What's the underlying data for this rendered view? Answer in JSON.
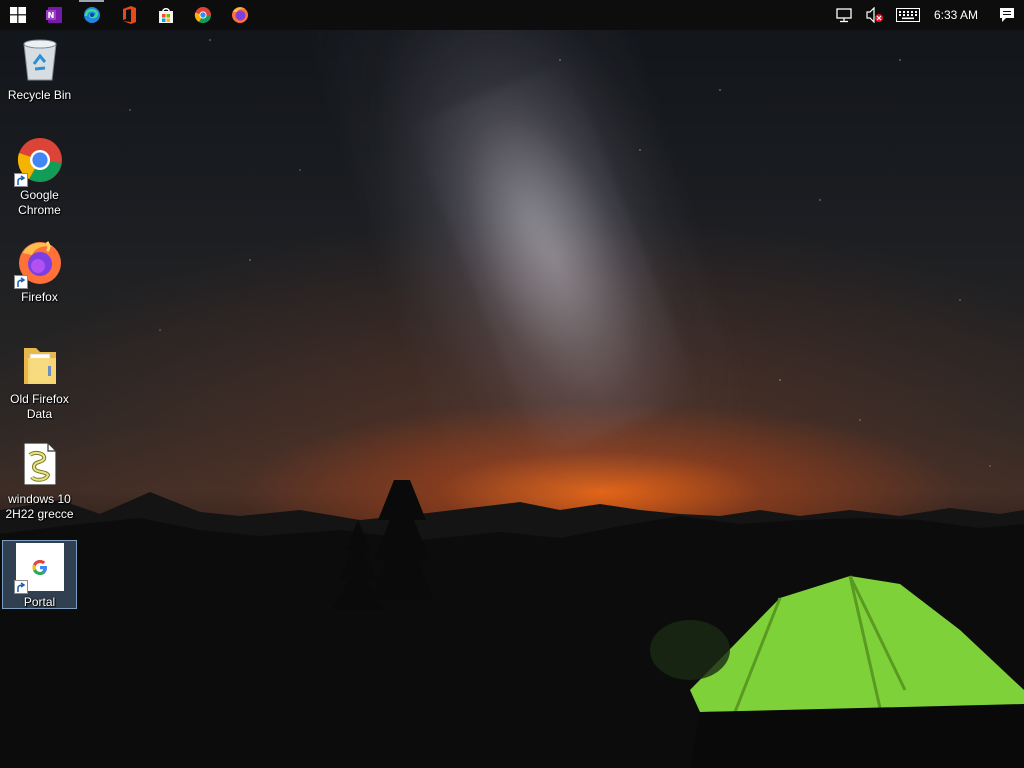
{
  "taskbar": {
    "apps": [
      {
        "id": "start",
        "icon": "windows-logo-icon"
      },
      {
        "id": "onenote",
        "icon": "onenote-icon"
      },
      {
        "id": "edge",
        "icon": "edge-icon"
      },
      {
        "id": "office",
        "icon": "office-icon"
      },
      {
        "id": "store",
        "icon": "microsoft-store-icon"
      },
      {
        "id": "chrome",
        "icon": "chrome-icon"
      },
      {
        "id": "firefox",
        "icon": "firefox-icon"
      }
    ],
    "tray": {
      "network_icon": "network-icon",
      "volume_icon": "volume-muted-icon",
      "keyboard_icon": "touch-keyboard-icon",
      "time": "6:33 AM",
      "notification_icon": "action-center-icon"
    }
  },
  "desktop": {
    "icons": [
      {
        "label": "Recycle Bin",
        "icon": "recycle-bin-icon",
        "shortcut": false,
        "selected": false
      },
      {
        "label": "Google\nChrome",
        "icon": "chrome-icon",
        "shortcut": true,
        "selected": false
      },
      {
        "label": "Firefox",
        "icon": "firefox-icon",
        "shortcut": true,
        "selected": false
      },
      {
        "label": "Old Firefox\nData",
        "icon": "folder-icon",
        "shortcut": false,
        "selected": false
      },
      {
        "label": "windows 10\n2H22 grecce",
        "icon": "script-file-icon",
        "shortcut": false,
        "selected": false
      },
      {
        "label": "Portal",
        "icon": "google-portal-icon",
        "shortcut": true,
        "selected": true
      }
    ]
  },
  "colors": {
    "taskbar_bg": "#0d0d0d",
    "selection": "#78aadc",
    "tent": "#7fd13a"
  }
}
